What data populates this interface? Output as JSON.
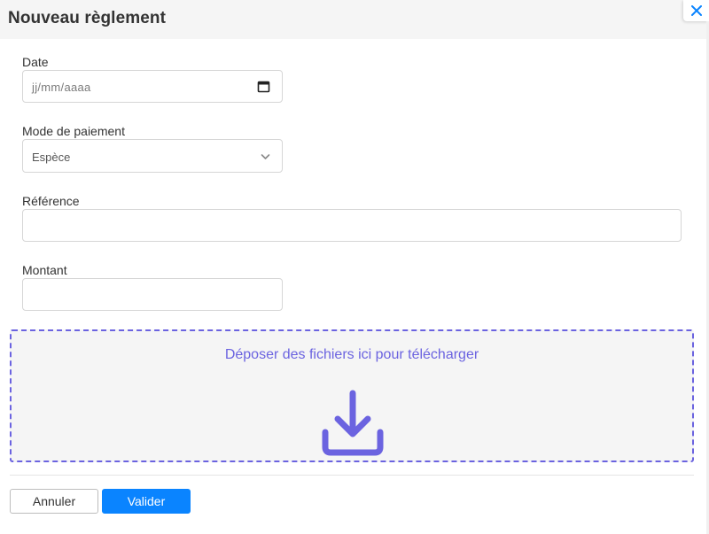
{
  "modal": {
    "title": "Nouveau règlement"
  },
  "form": {
    "date": {
      "label": "Date",
      "placeholder": "jj/mm/aaaa",
      "value": ""
    },
    "payment_mode": {
      "label": "Mode de paiement",
      "selected": "Espèce"
    },
    "reference": {
      "label": "Référence",
      "value": ""
    },
    "amount": {
      "label": "Montant",
      "value": ""
    }
  },
  "dropzone": {
    "text": "Déposer des fichiers ici pour télécharger"
  },
  "footer": {
    "cancel_label": "Annuler",
    "submit_label": "Valider"
  },
  "icons": {
    "close": "close-icon",
    "calendar": "calendar-icon",
    "chevron": "chevron-down-icon",
    "upload": "download-tray-icon"
  },
  "colors": {
    "accent": "#6b63e0",
    "primary_button": "#0a84ff",
    "close_icon": "#0a84ff",
    "header_bg": "#f5f5f5"
  }
}
